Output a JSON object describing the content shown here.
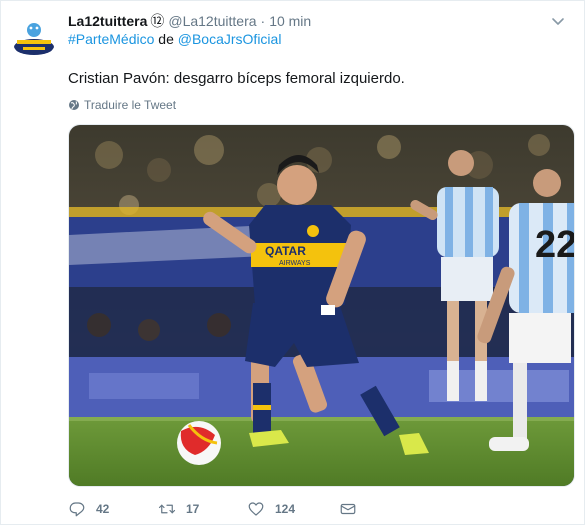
{
  "tweet": {
    "display_name": "La12tuittera",
    "badge": "⑫",
    "handle": "@La12tuittera",
    "separator": "·",
    "time": "10 min",
    "hashtag": "#ParteMédico",
    "connector": "de",
    "mention": "@BocaJrsOficial",
    "text": "Cristian Pavón: desgarro bíceps femoral izquierdo.",
    "translate_label": "Traduire le Tweet"
  },
  "actions": {
    "replies": "42",
    "retweets": "17",
    "likes": "124"
  },
  "media": {
    "jersey_sponsor": "QATAR",
    "jersey_sponsor_sub": "AIRWAYS",
    "player_number": "22"
  },
  "colors": {
    "link": "#1b95e0",
    "secondary_text": "#657786",
    "boca_blue": "#1c2f6b",
    "boca_gold": "#f4c20d",
    "racing_sky": "#7fb2e5"
  },
  "icons": {
    "reply": "reply-icon",
    "retweet": "retweet-icon",
    "like": "heart-icon",
    "message": "envelope-icon",
    "caret": "chevron-down-icon",
    "globe": "globe-icon"
  }
}
